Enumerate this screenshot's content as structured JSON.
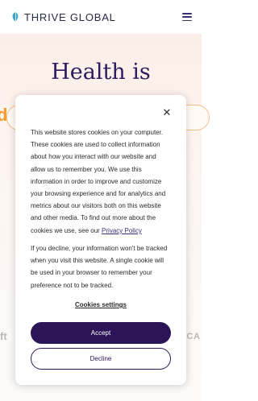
{
  "header": {
    "brand": "THRIVE GLOBAL",
    "brand_icon": "thrive-leaf-icon",
    "menu_icon": "hamburger-menu-icon",
    "brand_color": "#3aa8c1"
  },
  "hero": {
    "title": "Health is",
    "accent_fragment": "d",
    "faded_left_text": "ft",
    "faded_right_text": "ICA",
    "accent_color": "#f59b2e"
  },
  "cookie_banner": {
    "close_icon": "close-icon",
    "paragraph1_text": "This website stores cookies on your computer. These cookies are used to collect information about how you interact with our website and allow us to remember you. We use this information in order to improve and customize your browsing experience and for analytics and metrics about our visitors both on this website and other media. To find out more about the cookies we use, see our ",
    "privacy_link": "Privacy Policy",
    "paragraph2": "If you decline, your information won't be tracked when you visit this website. A single cookie will be used in your browser to remember your preference not to be tracked.",
    "settings_link": "Cookies settings",
    "accept_label": "Accept",
    "decline_label": "Decline",
    "button_color": "#2b1558"
  }
}
